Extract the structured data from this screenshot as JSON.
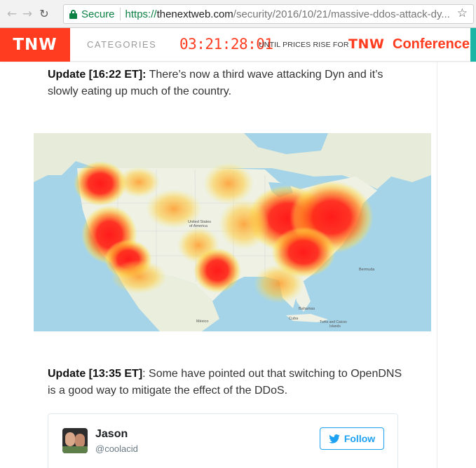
{
  "browser": {
    "nav": {
      "back_icon": "back-arrow-icon",
      "forward_icon": "forward-arrow-icon",
      "reload_icon": "reload-icon"
    },
    "security_label": "Secure",
    "url": {
      "protocol": "https://",
      "host": "thenextweb.com",
      "path": "/security/2016/10/21/massive-ddos-attack-dy..."
    },
    "star_icon": "bookmark-star-icon"
  },
  "header": {
    "logo": "TNW",
    "categories_label": "CATEGORIES",
    "countdown": "03:21:28:01",
    "until_text": "UNTIL PRICES RISE FOR",
    "conference_logo": "TNW",
    "conference_word": "Conference",
    "accent_color": "#ff3c1f"
  },
  "article": {
    "updates": [
      {
        "label": "Update [16:22 ET]:",
        "text": " There’s now a third wave attacking Dyn and it’s slowly eating up much of the country."
      },
      {
        "label": "Update [13:35 ET]",
        "text": ": Some have pointed out that switching to OpenDNS is a good way to mitigate the effect of the DDoS."
      }
    ],
    "map": {
      "labels": {
        "country": "United States\nof America",
        "mexico": "México",
        "bahamas": "Bahamas",
        "cuba": "Cuba",
        "turks": "Turks and Caicos\nIslands",
        "bermuda": "Bermuda"
      }
    }
  },
  "tweet": {
    "name": "Jason",
    "handle": "@coolacid",
    "follow_label": "Follow",
    "follow_icon": "twitter-bird-icon",
    "brand_color": "#1da1f2"
  }
}
